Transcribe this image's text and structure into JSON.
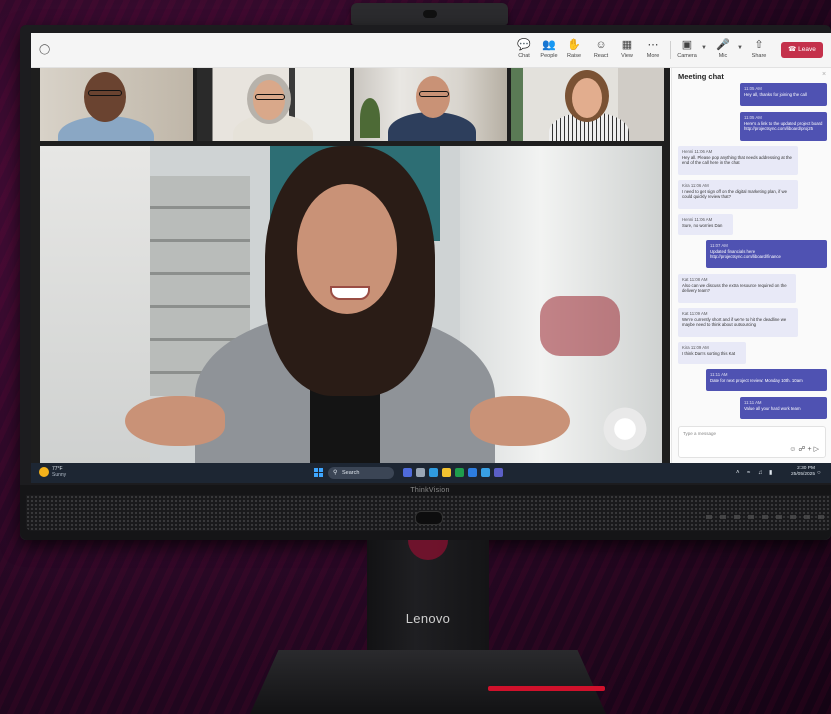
{
  "stand_brand": "Lenovo",
  "bezel_brand": "ThinkVision",
  "meeting": {
    "toolbar": {
      "chat": "Chat",
      "people": "People",
      "raise": "Raise",
      "react": "React",
      "view": "View",
      "more": "More",
      "camera": "Camera",
      "mic": "Mic",
      "share": "Share",
      "leave": "Leave"
    }
  },
  "chat": {
    "title": "Meeting chat",
    "compose_placeholder": "Type a message",
    "messages": [
      {
        "dir": "out",
        "time": "11:05 AM",
        "text": "Hey all, thanks for joining the call"
      },
      {
        "dir": "out",
        "time": "11:05 AM",
        "text": "Here's a link to the updated project board http://projectsync.com/liboard/proj25"
      },
      {
        "dir": "in",
        "time": "Henni 11:06 AM",
        "text": "Hey all. Please pop anything that needs addressing at the end of the call here in the chat"
      },
      {
        "dir": "in",
        "time": "Kira 11:06 AM",
        "text": "I need to get sign off on the digital marketing plan, if we could quickly review that?"
      },
      {
        "dir": "in",
        "time": "Henni 11:06 AM",
        "text": "Sure, no worries Dan"
      },
      {
        "dir": "out",
        "time": "11:07 AM",
        "text": "Updated financials here http://projectsync.com/liboard/finance"
      },
      {
        "dir": "in",
        "time": "Kat 11:08 AM",
        "text": "Also can we discuss the extra resource required on the delivery team?"
      },
      {
        "dir": "in",
        "time": "Kat 11:09 AM",
        "text": "We're currently short and if we're to hit the deadline we maybe need to think about outsourcing"
      },
      {
        "dir": "in",
        "time": "Kira 11:09 AM",
        "text": "I think Dan's sorting this Kat"
      },
      {
        "dir": "out",
        "time": "11:11 AM",
        "text": "Date for next project review: Monday 10th. 10am"
      },
      {
        "dir": "out",
        "time": "11:11 AM",
        "text": "Value all your hard work team"
      }
    ]
  },
  "taskbar": {
    "weather_temp": "77°F",
    "weather_cond": "Sunny",
    "search": "Search",
    "time": "2:30 PM",
    "date": "25/05/2025"
  },
  "colors": {
    "accent": "#4f52b2",
    "leave": "#c4314b",
    "brand_red": "#d0112b"
  }
}
